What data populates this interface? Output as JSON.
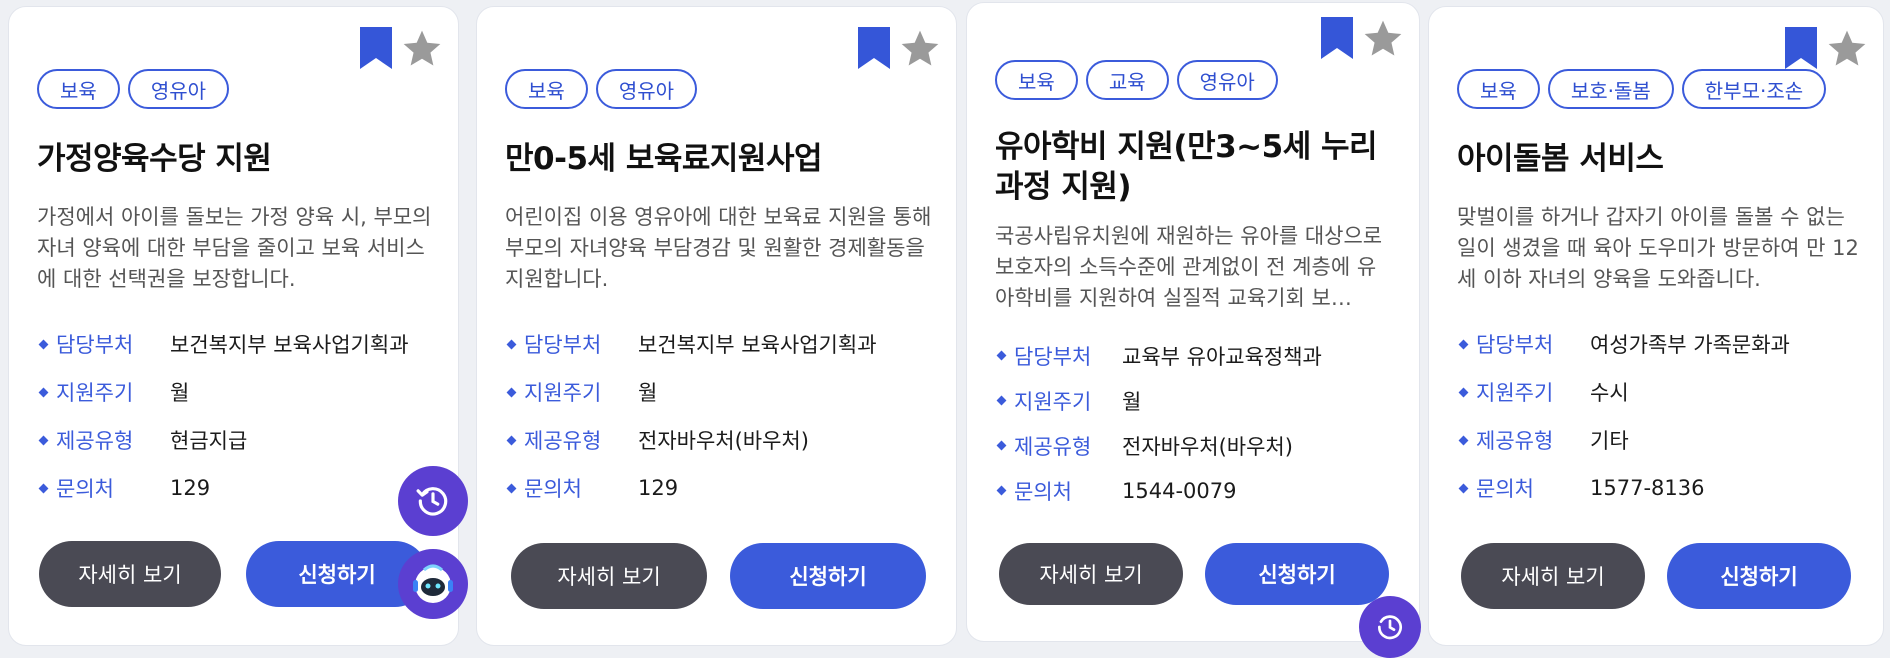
{
  "cards": [
    {
      "tags": [
        "보육",
        "영유아"
      ],
      "title": "가정양육수당 지원",
      "description": "가정에서 아이를 돌보는 가정 양육 시, 부모의 자녀 양육에 대한 부담을 줄이고 보육 서비스에 대한 선택권을 보장합니다.",
      "info": [
        {
          "label": "담당부처",
          "value": "보건복지부 보육사업기획과"
        },
        {
          "label": "지원주기",
          "value": "월"
        },
        {
          "label": "제공유형",
          "value": "현금지급"
        },
        {
          "label": "문의처",
          "value": "129"
        }
      ],
      "detail_label": "자세히 보기",
      "apply_label": "신청하기"
    },
    {
      "tags": [
        "보육",
        "영유아"
      ],
      "title": "만0-5세 보육료지원사업",
      "description": "어린이집 이용 영유아에 대한 보육료 지원을 통해 부모의 자녀양육 부담경감 및 원활한 경제활동을 지원합니다.",
      "info": [
        {
          "label": "담당부처",
          "value": "보건복지부 보육사업기획과"
        },
        {
          "label": "지원주기",
          "value": "월"
        },
        {
          "label": "제공유형",
          "value": "전자바우처(바우처)"
        },
        {
          "label": "문의처",
          "value": "129"
        }
      ],
      "detail_label": "자세히 보기",
      "apply_label": "신청하기"
    },
    {
      "tags": [
        "보육",
        "교육",
        "영유아"
      ],
      "title": "유아학비 지원(만3~5세 누리과정 지원)",
      "description": "국공사립유치원에 재원하는 유아를 대상으로 보호자의 소득수준에 관계없이 전 계층에 유아학비를 지원하여 실질적 교육기회 보…",
      "info": [
        {
          "label": "담당부처",
          "value": "교육부 유아교육정책과"
        },
        {
          "label": "지원주기",
          "value": "월"
        },
        {
          "label": "제공유형",
          "value": "전자바우처(바우처)"
        },
        {
          "label": "문의처",
          "value": "1544-0079"
        }
      ],
      "detail_label": "자세히 보기",
      "apply_label": "신청하기"
    },
    {
      "tags": [
        "보육",
        "보호·돌봄",
        "한부모·조손"
      ],
      "title": "아이돌봄 서비스",
      "description": "맞벌이를 하거나 갑자기 아이를 돌볼 수 없는 일이 생겼을 때 육아 도우미가 방문하여 만 12세 이하 자녀의 양육을 도와줍니다.",
      "info": [
        {
          "label": "담당부처",
          "value": "여성가족부 가족문화과"
        },
        {
          "label": "지원주기",
          "value": "수시"
        },
        {
          "label": "제공유형",
          "value": "기타"
        },
        {
          "label": "문의처",
          "value": "1577-8136"
        }
      ],
      "detail_label": "자세히 보기",
      "apply_label": "신청하기"
    }
  ],
  "icons": {
    "bookmark": "bookmark-icon",
    "star": "star-icon",
    "history": "history-icon",
    "chatbot": "chatbot-icon"
  },
  "colors": {
    "accent": "#3b5bdb",
    "bookmark": "#3556d8",
    "star": "#9a9a9a",
    "detail_button": "#4a4a54",
    "fab": "#5b3fd1"
  }
}
